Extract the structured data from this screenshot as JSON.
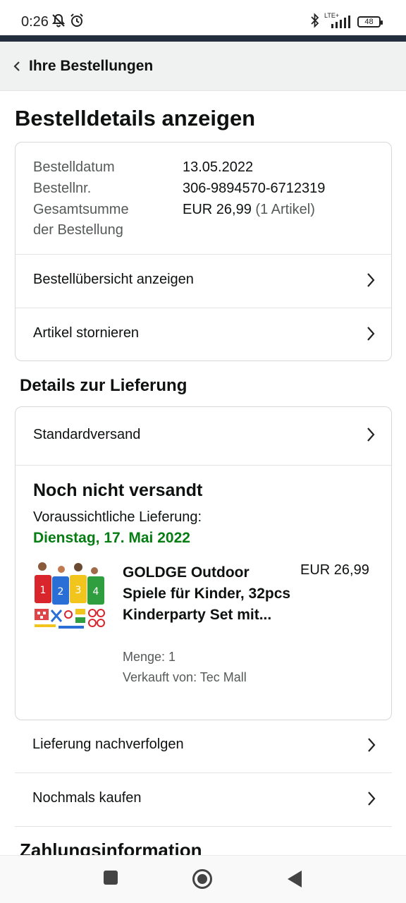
{
  "status_bar": {
    "time": "0:26",
    "network": "LTE+",
    "battery": "48"
  },
  "header": {
    "title": "Ihre Bestellungen"
  },
  "page": {
    "title": "Bestelldetails anzeigen"
  },
  "order": {
    "date_label": "Bestelldatum",
    "date_value": "13.05.2022",
    "number_label": "Bestellnr.",
    "number_value": "306-9894570-6712319",
    "total_label_line1": "Gesamtsumme",
    "total_label_line2": "der Bestellung",
    "total_value": "EUR 26,99",
    "total_count": "(1 Artikel)",
    "actions": [
      {
        "label": "Bestellübersicht anzeigen"
      },
      {
        "label": "Artikel stornieren"
      }
    ]
  },
  "delivery": {
    "section_title": "Details zur Lieferung",
    "shipping_method": "Standardversand",
    "status": "Noch nicht versandt",
    "expected_label": "Voraussichtliche Lieferung:",
    "expected_date": "Dienstag, 17. Mai 2022",
    "expected_date_color": "#067d12",
    "product": {
      "name": "GOLDGE Outdoor Spiele für Kinder, 32pcs Kinderparty Set mit...",
      "price": "EUR 26,99",
      "quantity": "Menge: 1",
      "seller": "Verkauft von: Tec Mall"
    }
  },
  "more_actions": [
    {
      "label": "Lieferung nachverfolgen"
    },
    {
      "label": "Nochmals kaufen"
    }
  ],
  "next_section_title": "Zahlungsinformation",
  "colors": {
    "accent_strip": "#232f3e",
    "header_bg": "#f0f2f2"
  }
}
